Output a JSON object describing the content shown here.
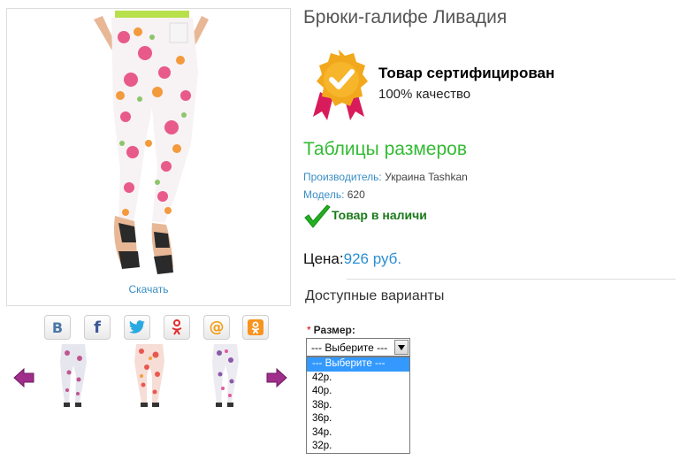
{
  "product": {
    "title": "Брюки-галифе Ливадия",
    "download_link": "Скачать",
    "certified_title": "Товар сертифицирован",
    "certified_subtitle": "100% качество",
    "sizes_table_link": "Таблицы размеров",
    "maker_label": "Производитель:",
    "maker_value": "Украина Tashkan",
    "model_label": "Модель:",
    "model_value": "620",
    "stock_status": "Товар в наличи",
    "price_label": "Цена:",
    "price_value": "926 руб.",
    "variants_heading": "Доступные варианты"
  },
  "social": {
    "icons": [
      "vk-icon",
      "facebook-icon",
      "twitter-icon",
      "odnoklassniki-icon",
      "mailru-icon",
      "ok-ru-icon"
    ],
    "vk_glyph": "B",
    "fb_glyph": "f",
    "mail_glyph": "@"
  },
  "size_option": {
    "required_mark": "*",
    "label": "Размер:",
    "selected": "--- Выберите ---",
    "options": [
      "--- Выберите ---",
      "42р.",
      "40р.",
      "38р.",
      "36р.",
      "34р.",
      "32р."
    ]
  },
  "colors": {
    "accent_blue": "#3a8ec6",
    "accent_green": "#33bb33",
    "stock_green": "#1a7a1a",
    "arrow_magenta": "#9b2a8a",
    "selected_option": "#3399ff"
  }
}
